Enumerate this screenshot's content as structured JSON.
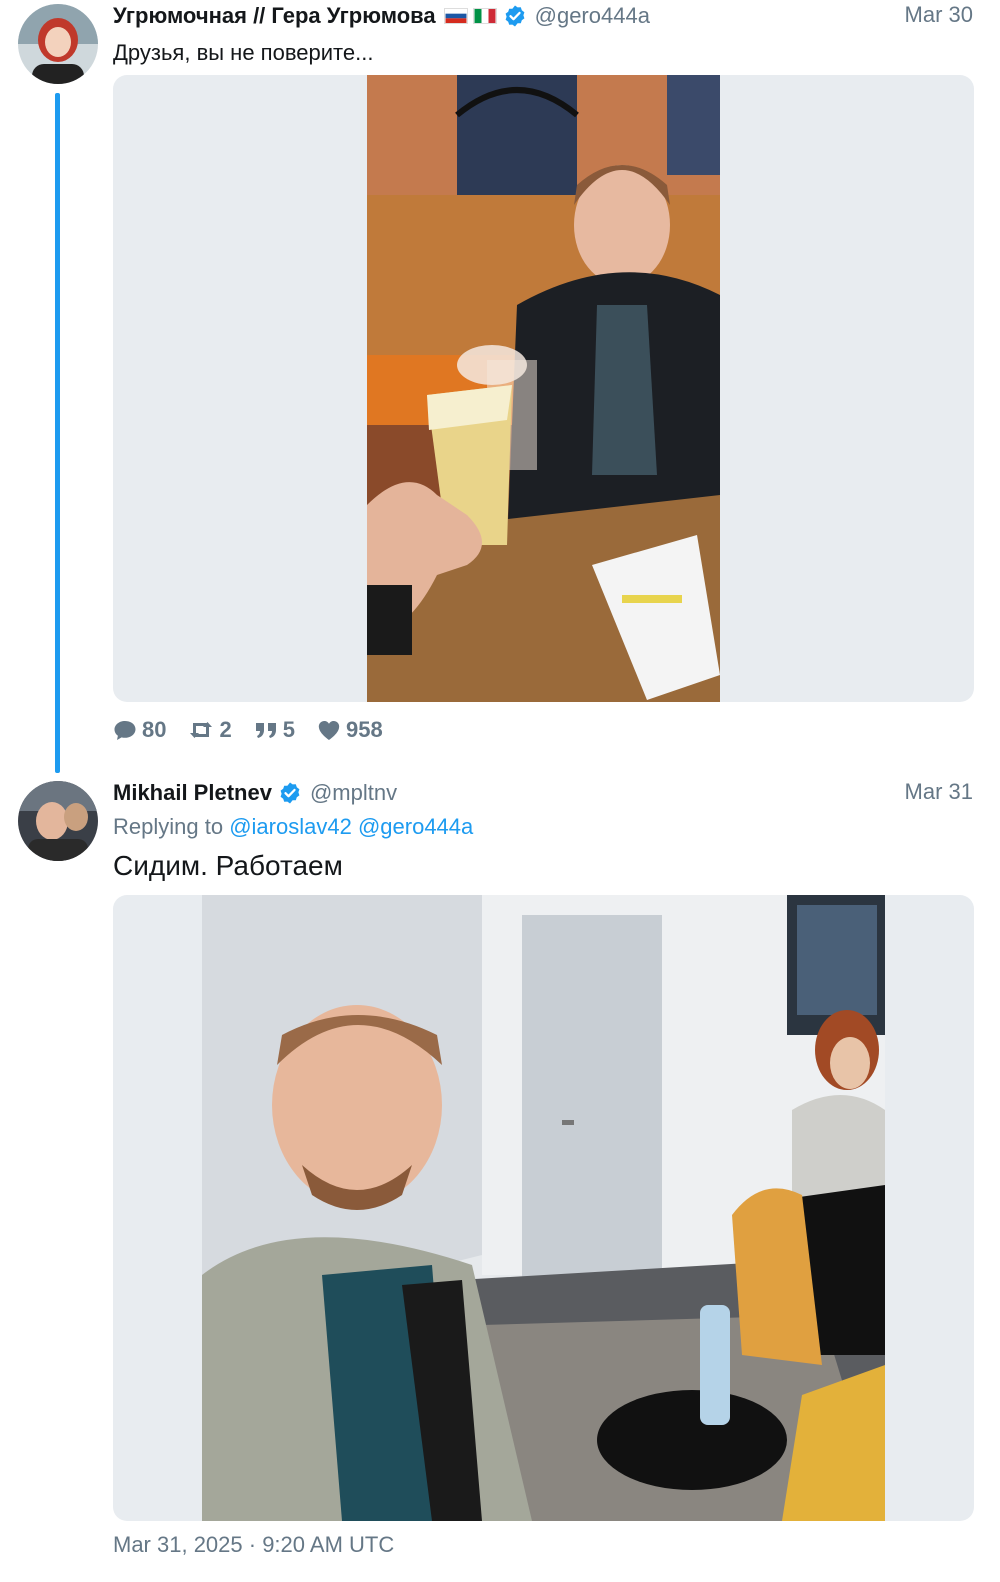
{
  "tweets": [
    {
      "author_name": "Угрюмочная // Гера Угрюмова",
      "handle": "@gero444a",
      "date": "Mar 30",
      "text": "Друзья, вы не поверите...",
      "stats": {
        "replies": "80",
        "retweets": "2",
        "quotes": "5",
        "likes": "958"
      }
    },
    {
      "author_name": "Mikhail Pletnev",
      "handle": "@mpltnv",
      "date": "Mar 31",
      "replying_prefix": "Replying to",
      "mentions": [
        "@iaroslav42",
        "@gero444a"
      ],
      "text": "Сидим. Работаем",
      "timestamp": "Mar 31, 2025 · 9:20 AM UTC"
    }
  ],
  "colors": {
    "accent": "#1d9bf0",
    "muted": "#657786",
    "media_bg": "#e8ecf0"
  },
  "icons": [
    "verified-icon",
    "flag-russia-icon",
    "flag-italy-icon",
    "comment-icon",
    "retweet-icon",
    "quote-icon",
    "heart-icon"
  ]
}
